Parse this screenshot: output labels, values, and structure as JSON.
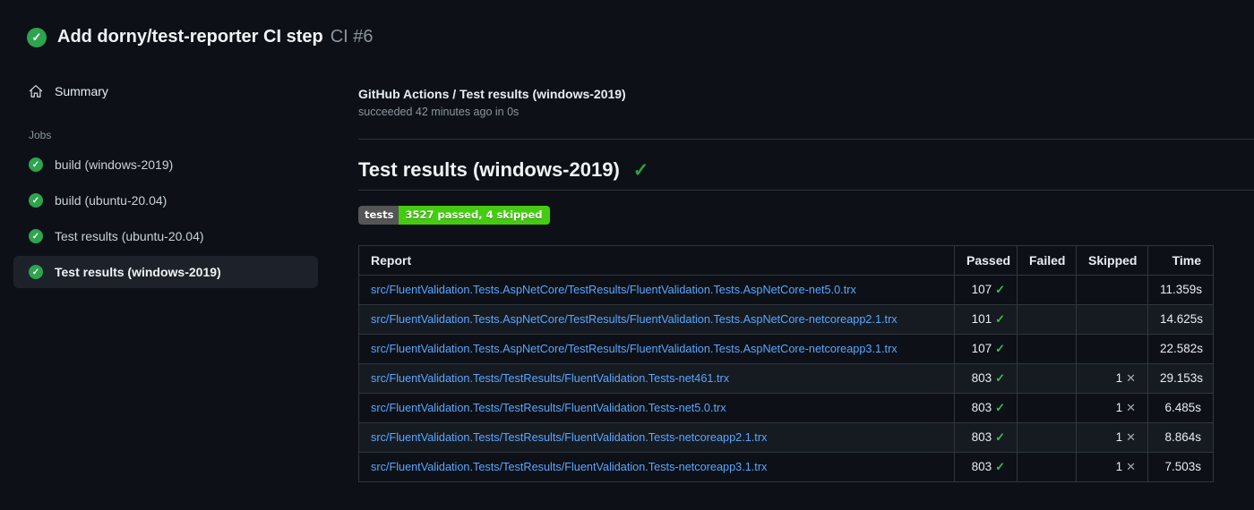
{
  "icons": {
    "check": "✓",
    "cross": "✕"
  },
  "colors": {
    "background": "#0d1117",
    "success_green": "#2ea44f",
    "link_blue": "#58a6ff",
    "badge_label_bg": "#555555",
    "badge_value_bg": "#44cc11",
    "table_border": "#30363d",
    "row_alt_bg": "#161b22"
  },
  "header": {
    "title": "Add dorny/test-reporter CI step",
    "run_number": "CI #6"
  },
  "sidebar": {
    "summary_label": "Summary",
    "jobs_section_label": "Jobs",
    "jobs": [
      {
        "label": "build (windows-2019)",
        "selected": false
      },
      {
        "label": "build (ubuntu-20.04)",
        "selected": false
      },
      {
        "label": "Test results (ubuntu-20.04)",
        "selected": false
      },
      {
        "label": "Test results (windows-2019)",
        "selected": true
      }
    ]
  },
  "main": {
    "check_title": "GitHub Actions / Test results (windows-2019)",
    "check_status": "succeeded 42 minutes ago in 0s",
    "heading": "Test results (windows-2019)",
    "badge": {
      "label": "tests",
      "value": "3527 passed, 4 skipped",
      "label_bg": "#555555",
      "value_bg": "#44cc11"
    },
    "table": {
      "columns": [
        "Report",
        "Passed",
        "Failed",
        "Skipped",
        "Time"
      ],
      "rows": [
        {
          "report": "src/FluentValidation.Tests.AspNetCore/TestResults/FluentValidation.Tests.AspNetCore-net5.0.trx",
          "passed": "107",
          "failed": "",
          "skipped": "",
          "time": "11.359s"
        },
        {
          "report": "src/FluentValidation.Tests.AspNetCore/TestResults/FluentValidation.Tests.AspNetCore-netcoreapp2.1.trx",
          "passed": "101",
          "failed": "",
          "skipped": "",
          "time": "14.625s"
        },
        {
          "report": "src/FluentValidation.Tests.AspNetCore/TestResults/FluentValidation.Tests.AspNetCore-netcoreapp3.1.trx",
          "passed": "107",
          "failed": "",
          "skipped": "",
          "time": "22.582s"
        },
        {
          "report": "src/FluentValidation.Tests/TestResults/FluentValidation.Tests-net461.trx",
          "passed": "803",
          "failed": "",
          "skipped": "1",
          "time": "29.153s"
        },
        {
          "report": "src/FluentValidation.Tests/TestResults/FluentValidation.Tests-net5.0.trx",
          "passed": "803",
          "failed": "",
          "skipped": "1",
          "time": "6.485s"
        },
        {
          "report": "src/FluentValidation.Tests/TestResults/FluentValidation.Tests-netcoreapp2.1.trx",
          "passed": "803",
          "failed": "",
          "skipped": "1",
          "time": "8.864s"
        },
        {
          "report": "src/FluentValidation.Tests/TestResults/FluentValidation.Tests-netcoreapp3.1.trx",
          "passed": "803",
          "failed": "",
          "skipped": "1",
          "time": "7.503s"
        }
      ]
    }
  }
}
